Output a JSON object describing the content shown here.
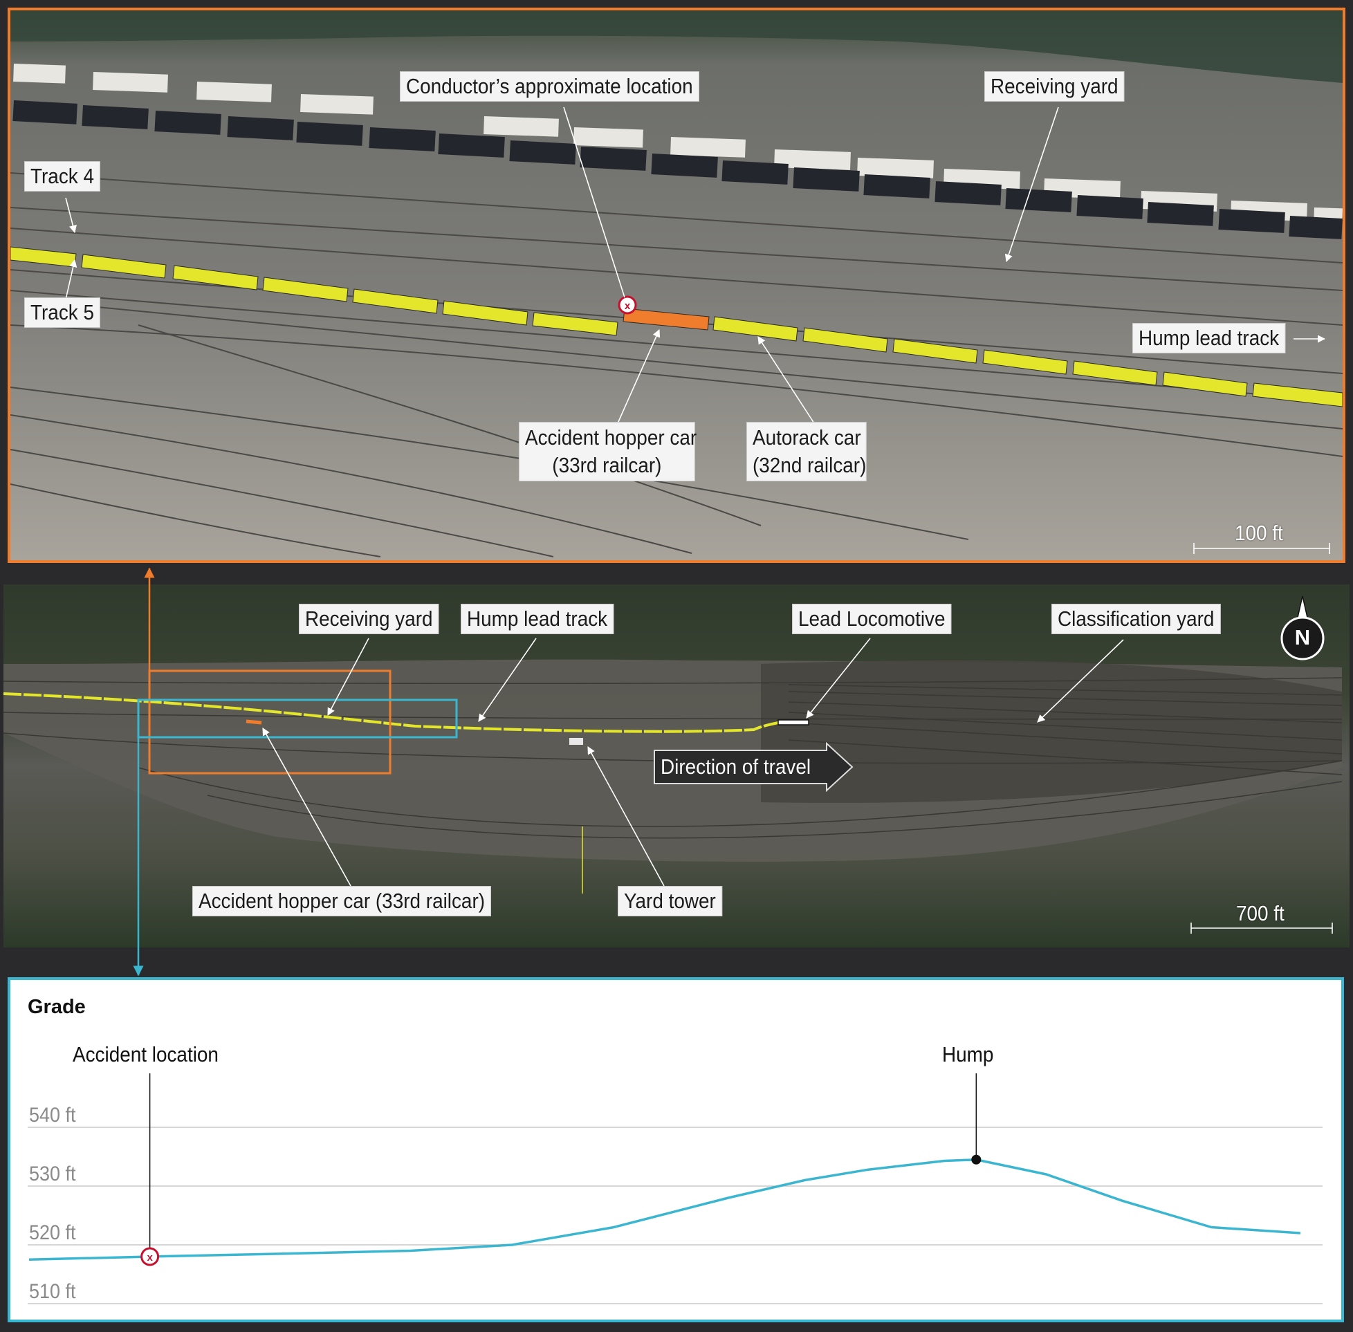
{
  "colors": {
    "detail_frame": "#ef7d2d",
    "grade_frame": "#3bb6d0",
    "train_car": "#e3e62a",
    "accident_car": "#ef7d2d",
    "profile_line": "#3bb6d0",
    "accident_marker": "#c8102e"
  },
  "detail_map": {
    "labels": {
      "conductor": "Conductor’s approximate location",
      "receiving_yard": "Receiving yard",
      "track4": "Track 4",
      "track5": "Track 5",
      "hump_lead": "Hump lead track",
      "hopper_line1": "Accident hopper car",
      "hopper_line2": "(33rd railcar)",
      "autorack_line1": "Autorack car",
      "autorack_line2": "(32nd railcar)"
    },
    "scale": "100 ft"
  },
  "overview_map": {
    "labels": {
      "receiving_yard": "Receiving yard",
      "hump_lead": "Hump lead track",
      "lead_loco": "Lead Locomotive",
      "class_yard": "Classification yard",
      "direction": "Direction of travel",
      "hopper": "Accident hopper car (33rd railcar)",
      "yard_tower": "Yard tower"
    },
    "north": "N",
    "scale": "700 ft"
  },
  "grade": {
    "title": "Grade",
    "accident_label": "Accident location",
    "hump_label": "Hump",
    "chart_data": {
      "type": "line",
      "title": "Grade",
      "y_ticks": [
        "540 ft",
        "530 ft",
        "520 ft",
        "510 ft"
      ],
      "ylim": [
        510,
        540
      ],
      "grid": true,
      "series": [
        {
          "x": [
            0,
            0.095,
            0.2,
            0.3,
            0.38,
            0.46,
            0.55,
            0.61,
            0.66,
            0.72,
            0.745,
            0.8,
            0.86,
            0.93,
            1.0
          ],
          "values": [
            517.5,
            518.0,
            518.5,
            519.0,
            520.0,
            523.0,
            528.0,
            531.0,
            532.8,
            534.3,
            534.5,
            532.0,
            527.5,
            523.0,
            522.0
          ]
        }
      ],
      "annotations": [
        {
          "label": "Accident location",
          "x": 0.095
        },
        {
          "label": "Hump",
          "x": 0.745
        }
      ]
    }
  }
}
